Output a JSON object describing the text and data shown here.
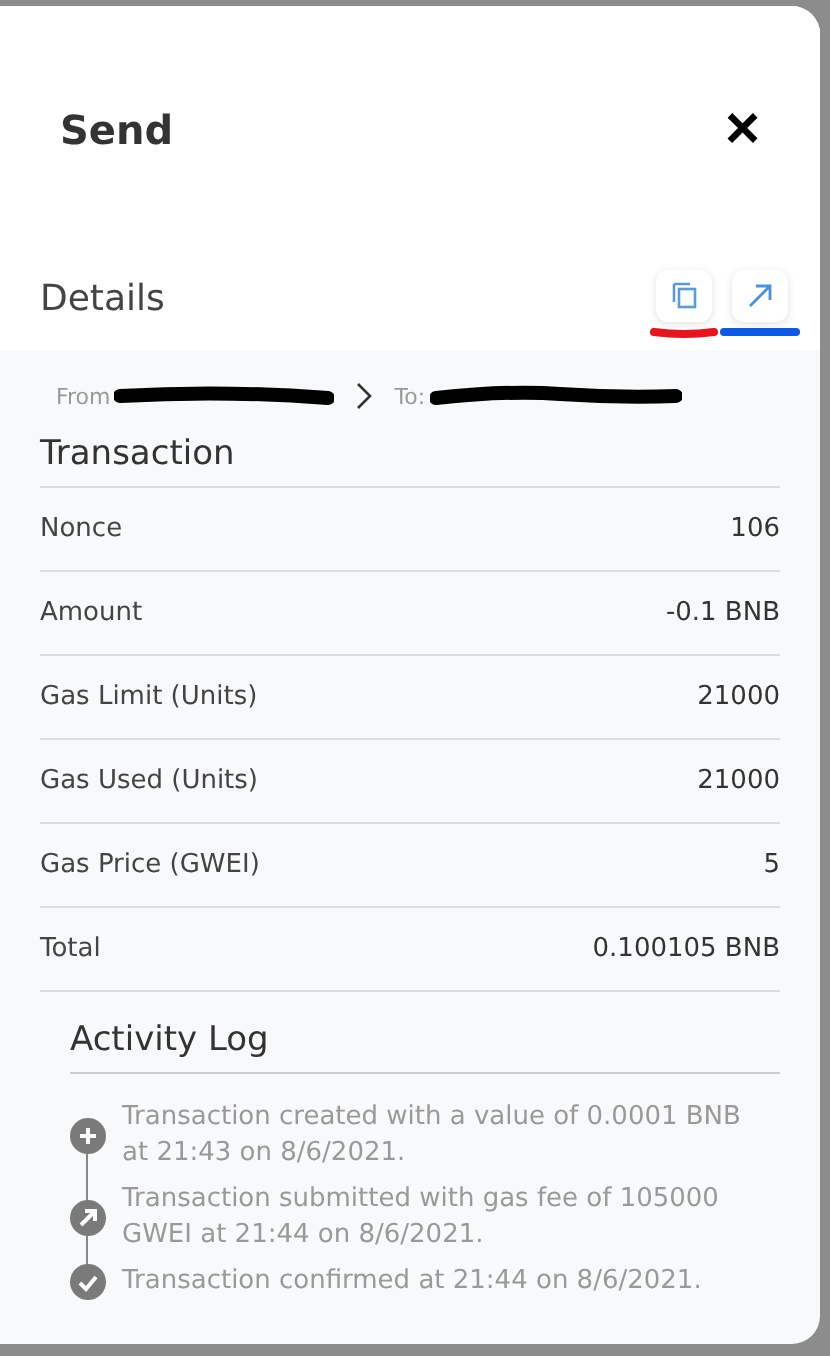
{
  "modal": {
    "title": "Send",
    "close": "×"
  },
  "details": {
    "title": "Details",
    "from_label": "From",
    "to_label": "To:"
  },
  "transaction": {
    "title": "Transaction",
    "rows": [
      {
        "label": "Nonce",
        "value": "106"
      },
      {
        "label": "Amount",
        "value": "-0.1 BNB"
      },
      {
        "label": "Gas Limit (Units)",
        "value": "21000"
      },
      {
        "label": "Gas Used (Units)",
        "value": "21000"
      },
      {
        "label": "Gas Price (GWEI)",
        "value": "5"
      },
      {
        "label": "Total",
        "value": "0.100105 BNB"
      }
    ]
  },
  "activity_log": {
    "title": "Activity Log",
    "entries": [
      {
        "kind": "created",
        "text": "Transaction created with a value of 0.0001 BNB at 21:43 on 8/6/2021."
      },
      {
        "kind": "submitted",
        "text": "Transaction submitted with gas fee of 105000 GWEI at 21:44 on 8/6/2021."
      },
      {
        "kind": "confirmed",
        "text": "Transaction confirmed at 21:44 on 8/6/2021."
      }
    ]
  }
}
